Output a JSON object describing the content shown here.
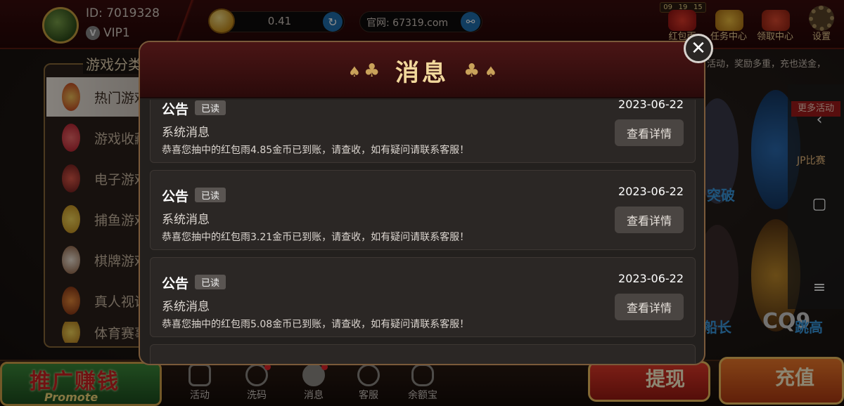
{
  "top_bar": {
    "user_id": "ID: 7019328",
    "vip_icon": "V",
    "vip_level": "VIP1",
    "balance": "0.41",
    "website": "官网: 67319.com",
    "timer": [
      "09",
      "19",
      "15"
    ],
    "icons": [
      {
        "label": "红包雨",
        "icon": "red-envelope-icon"
      },
      {
        "label": "任务中心",
        "icon": "task-center-icon"
      },
      {
        "label": "领取中心",
        "icon": "claim-center-icon"
      },
      {
        "label": "设置",
        "icon": "gear-icon"
      }
    ],
    "marquee": "活动，奖励多重，充也送金，"
  },
  "categories": {
    "title": "游戏分类",
    "items": [
      {
        "label": "热门游戏",
        "active": true
      },
      {
        "label": "游戏收藏",
        "active": false
      },
      {
        "label": "电子游戏",
        "active": false
      },
      {
        "label": "捕鱼游戏",
        "active": false
      },
      {
        "label": "棋牌游戏",
        "active": false
      },
      {
        "label": "真人视讯",
        "active": false
      },
      {
        "label": "体育赛事",
        "active": false
      }
    ]
  },
  "side_panel": {
    "more_activities": "更多活动",
    "jp_label": "JP比赛",
    "game_texts": [
      "突破",
      "船长",
      "CQ9",
      "跳高"
    ]
  },
  "bottom_bar": {
    "promote_main": "推广赚钱",
    "promote_sub": "Promote",
    "nav": [
      {
        "label": "活动",
        "icon": "gift-icon",
        "badge": false
      },
      {
        "label": "洗码",
        "icon": "chips-icon",
        "badge": true
      },
      {
        "label": "消息",
        "icon": "message-icon",
        "badge": true
      },
      {
        "label": "客服",
        "icon": "support-icon",
        "badge": false
      },
      {
        "label": "余额宝",
        "icon": "treasure-icon",
        "badge": false
      }
    ],
    "withdraw": "提现",
    "recharge": "充值"
  },
  "modal": {
    "title": "消息",
    "close": "✕",
    "messages": [
      {
        "type": "公告",
        "status": "已读",
        "date": "2023-06-22",
        "subject": "系统消息",
        "body": "恭喜您抽中的红包雨4.85金币已到账，请查收，如有疑问请联系客服！",
        "button": "查看详情"
      },
      {
        "type": "公告",
        "status": "已读",
        "date": "2023-06-22",
        "subject": "系统消息",
        "body": "恭喜您抽中的红包雨3.21金币已到账，请查收，如有疑问请联系客服！",
        "button": "查看详情"
      },
      {
        "type": "公告",
        "status": "已读",
        "date": "2023-06-22",
        "subject": "系统消息",
        "body": "恭喜您抽中的红包雨5.08金币已到账，请查收，如有疑问请联系客服！",
        "button": "查看详情"
      }
    ]
  }
}
